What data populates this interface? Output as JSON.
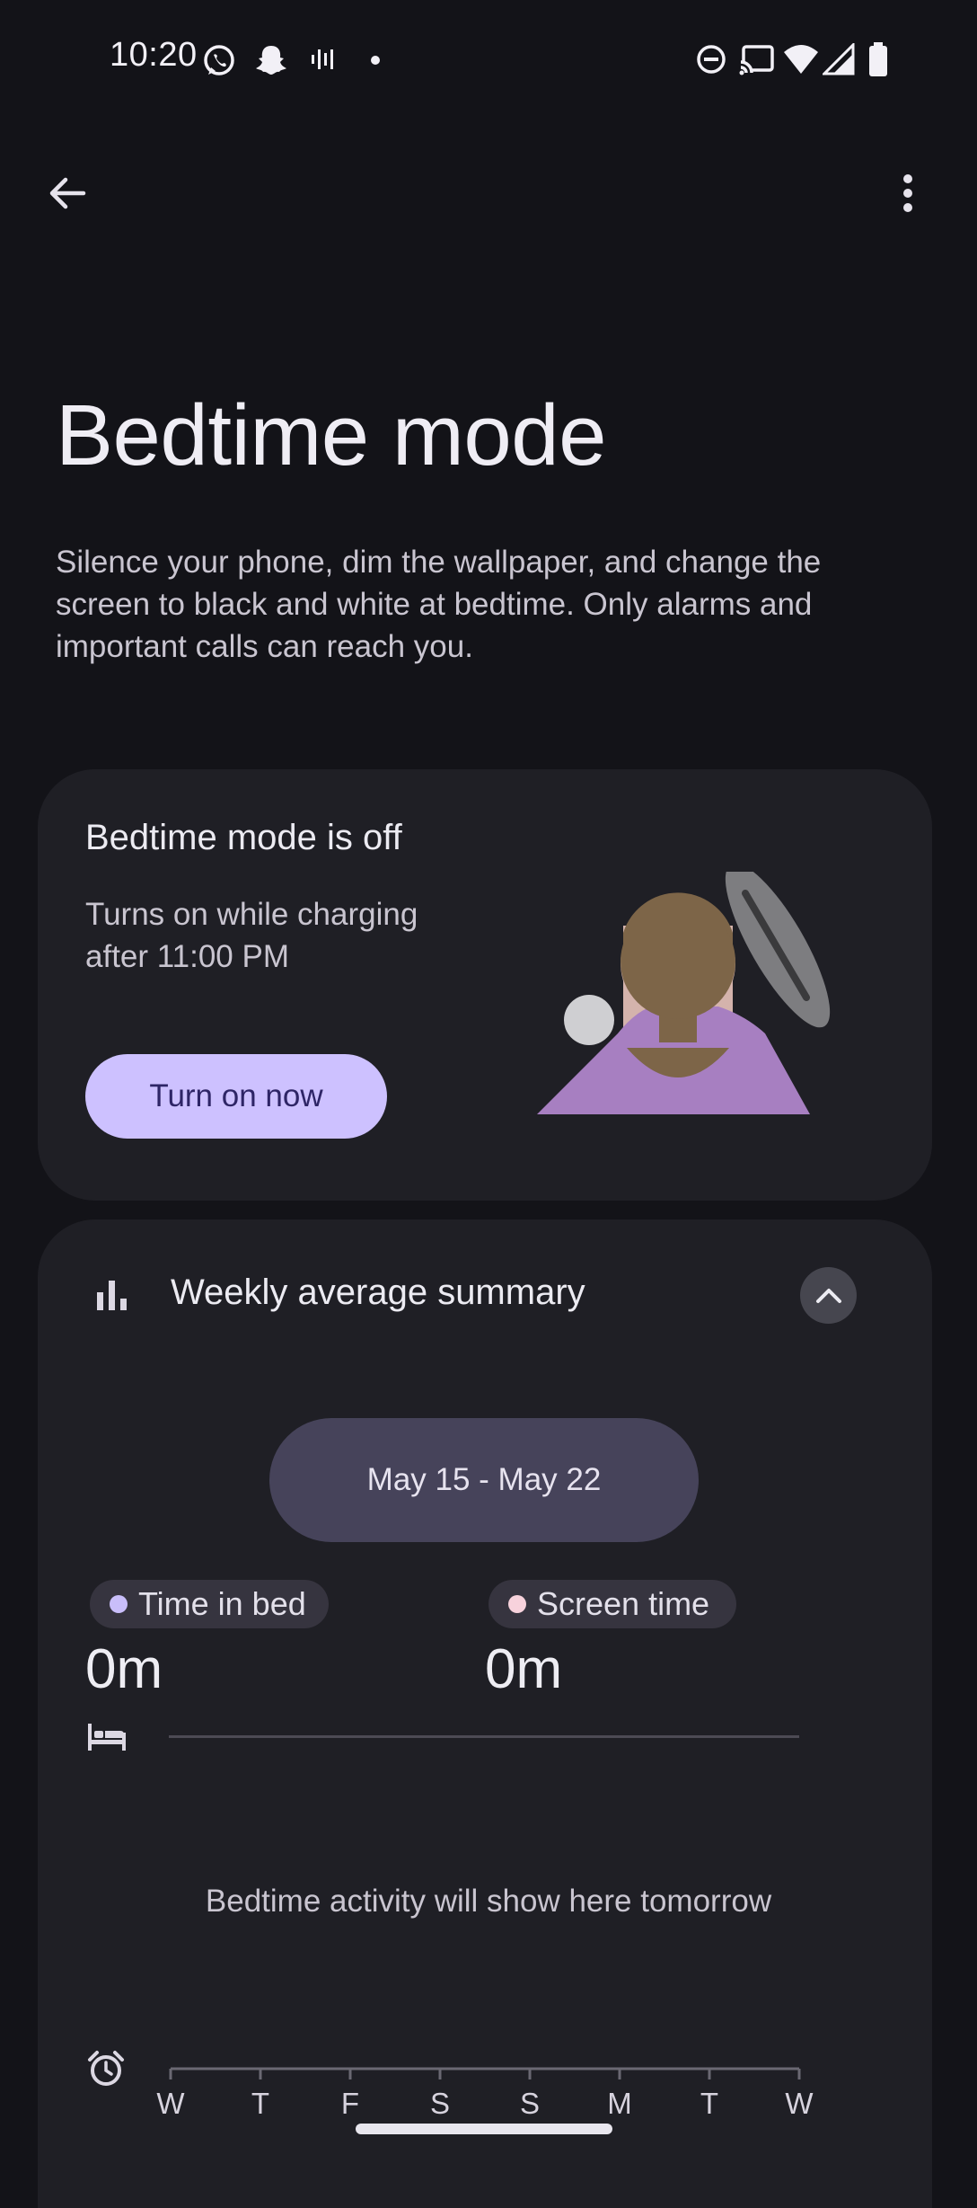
{
  "status_bar": {
    "time": "10:20",
    "left_icons": [
      "whatsapp-icon",
      "snapchat-icon",
      "voice-icon",
      "dot-icon"
    ],
    "right_icons": [
      "dnd-icon",
      "cast-icon",
      "wifi-icon",
      "signal-icon",
      "battery-icon"
    ]
  },
  "app_bar": {
    "back_icon": "arrow-back-icon",
    "more_icon": "more-vert-icon"
  },
  "page": {
    "title": "Bedtime mode",
    "description": "Silence your phone, dim the wallpaper, and change the screen to black and white at bedtime. Only alarms and important calls can reach you."
  },
  "status_card": {
    "title": "Bedtime mode is off",
    "subtitle": "Turns on while charging after 11:00 PM",
    "button_label": "Turn on now"
  },
  "summary_card": {
    "title": "Weekly average summary",
    "date_range": "May 15 - May 22",
    "metrics": [
      {
        "label": "Time in bed",
        "value": "0m",
        "dot_color": "#c9befa"
      },
      {
        "label": "Screen time",
        "value": "0m",
        "dot_color": "#f7d2dc"
      }
    ],
    "empty_message": "Bedtime activity will show here tomorrow",
    "days": [
      "W",
      "T",
      "F",
      "S",
      "S",
      "M",
      "T",
      "W"
    ]
  },
  "colors": {
    "background": "#131318",
    "card": "#1f1f25",
    "accent_button": "#cdc1ff",
    "date_pill": "#46435a"
  }
}
